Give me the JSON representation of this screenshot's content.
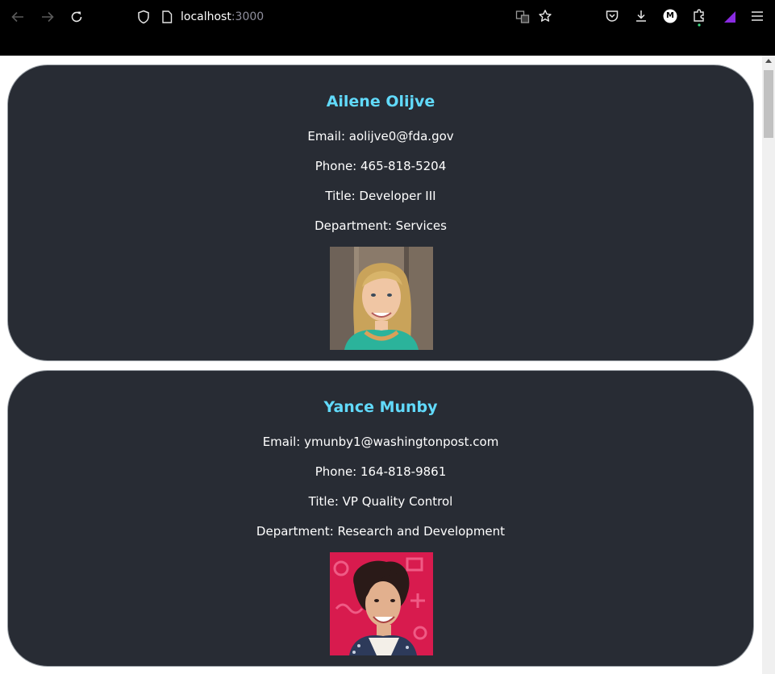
{
  "browser": {
    "url_host": "localhost",
    "url_port": ":3000",
    "icons": [
      "back-arrow-icon",
      "forward-arrow-icon",
      "reload-icon",
      "shield-icon",
      "page-icon",
      "translate-icon",
      "bookmark-star-icon",
      "pocket-icon",
      "download-icon",
      "account-icon",
      "extensions-icon",
      "extension-purple-icon",
      "menu-icon"
    ],
    "account_initial": "M"
  },
  "employees": [
    {
      "name": "Ailene Olijve",
      "email": "Email: aolijve0@fda.gov",
      "phone": "Phone: 465-818-5204",
      "title": "Title: Developer III",
      "department": "Department: Services"
    },
    {
      "name": "Yance Munby",
      "email": "Email: ymunby1@washingtonpost.com",
      "phone": "Phone: 164-818-9861",
      "title": "Title: VP Quality Control",
      "department": "Department: Research and Development"
    }
  ],
  "colors": {
    "card_bg": "#282c34",
    "name_color": "#61dafb",
    "toolbar_bg": "#000000"
  }
}
